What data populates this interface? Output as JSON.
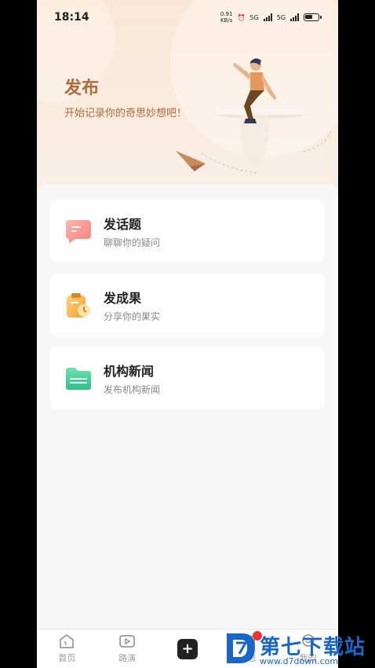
{
  "status": {
    "time": "18:14",
    "speed_value": "0.91",
    "speed_unit": "KB/s",
    "sig1": "5G",
    "sig2": "5G",
    "battery_level": 0.6
  },
  "hero": {
    "title": "发布",
    "subtitle": "开始记录你的奇思妙想吧！"
  },
  "cards": [
    {
      "title": "发话题",
      "desc": "聊聊你的疑问",
      "icon": "chat-bubble-icon"
    },
    {
      "title": "发成果",
      "desc": "分享你的果实",
      "icon": "clipboard-icon"
    },
    {
      "title": "机构新闻",
      "desc": "发布机构新闻",
      "icon": "folder-icon"
    }
  ],
  "tabs": [
    {
      "label": "首页",
      "icon": "home-icon"
    },
    {
      "label": "路演",
      "icon": "video-icon"
    },
    {
      "label": "",
      "icon": "plus-icon"
    },
    {
      "label": "消息",
      "icon": "message-icon"
    },
    {
      "label": "我的",
      "icon": "profile-icon"
    }
  ],
  "watermark": {
    "text": "第七下载站",
    "url": "www.d7down.com"
  },
  "colors": {
    "accent": "#b06a3a",
    "hero_bg": "#fbe7d5",
    "watermark": "#1b67c9"
  }
}
